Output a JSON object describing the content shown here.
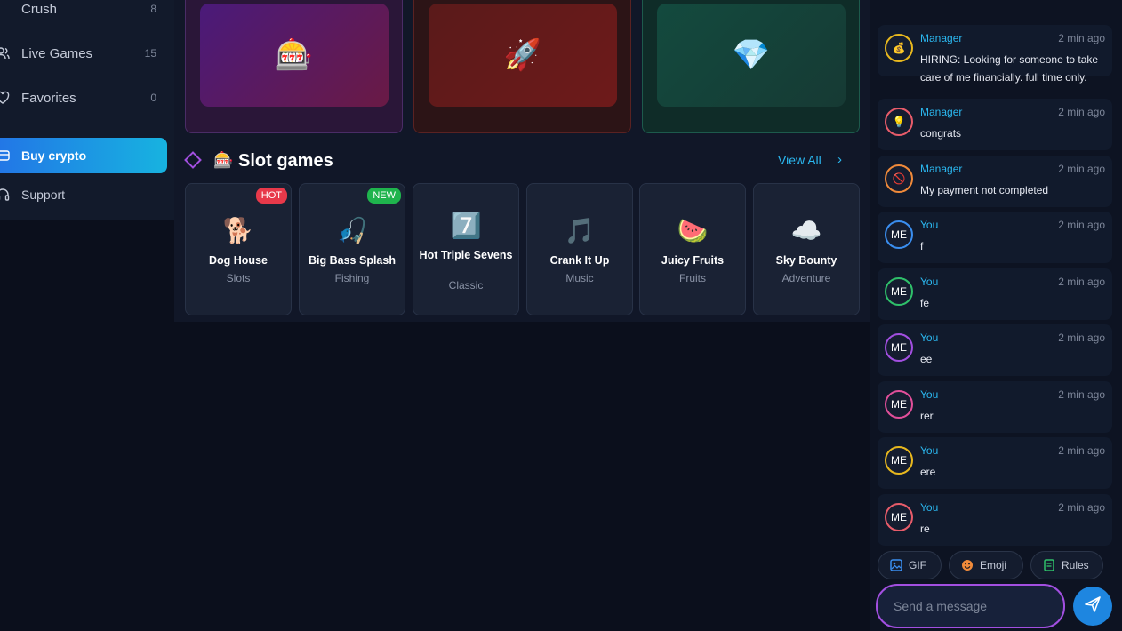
{
  "sidebar": {
    "items": [
      {
        "label": "Crush",
        "count": "8"
      },
      {
        "label": "Live Games",
        "count": "15"
      },
      {
        "label": "Favorites",
        "count": "0"
      }
    ],
    "buy_crypto": "Buy crypto",
    "support": "Support"
  },
  "featured": [
    {
      "emoji": "🎰"
    },
    {
      "emoji": "🚀"
    },
    {
      "emoji": "💎"
    }
  ],
  "slot_section": {
    "icon": "🎰",
    "title": "Slot games",
    "view_all": "View All",
    "chevron": "›"
  },
  "games": [
    {
      "emoji": "🐕",
      "name": "Dog House",
      "category": "Slots",
      "badge": "HOT"
    },
    {
      "emoji": "🎣",
      "name": "Big Bass Splash",
      "category": "Fishing",
      "badge": "NEW"
    },
    {
      "emoji": "7️⃣",
      "name": "Hot Triple Sevens",
      "category": "Classic"
    },
    {
      "emoji": "🎵",
      "name": "Crank It Up",
      "category": "Music"
    },
    {
      "emoji": "🍉",
      "name": "Juicy Fruits",
      "category": "Fruits"
    },
    {
      "emoji": "☁️",
      "name": "Sky Bounty",
      "category": "Adventure"
    }
  ],
  "chat": {
    "messages": [
      {
        "user": "Manager",
        "time": "2 min ago",
        "text": "HIRING: Looking for someone to take care of me financially. full time only.",
        "avatar": "💰",
        "ring": "#e8b81e"
      },
      {
        "user": "Manager",
        "time": "2 min ago",
        "text": "congrats",
        "avatar": "💡",
        "ring": "#e85c6a"
      },
      {
        "user": "Manager",
        "time": "2 min ago",
        "text": "My payment not completed",
        "avatar": "🚫",
        "ring": "#f08a3a"
      },
      {
        "user": "You",
        "time": "2 min ago",
        "text": "f",
        "avatar": "ME",
        "ring": "#3a8ef0"
      },
      {
        "user": "You",
        "time": "2 min ago",
        "text": "fe",
        "avatar": "ME",
        "ring": "#2fc06a"
      },
      {
        "user": "You",
        "time": "2 min ago",
        "text": "ee",
        "avatar": "ME",
        "ring": "#a24fe0"
      },
      {
        "user": "You",
        "time": "2 min ago",
        "text": "rer",
        "avatar": "ME",
        "ring": "#e24f9a"
      },
      {
        "user": "You",
        "time": "2 min ago",
        "text": "ere",
        "avatar": "ME",
        "ring": "#e8b81e"
      },
      {
        "user": "You",
        "time": "2 min ago",
        "text": "re",
        "avatar": "ME",
        "ring": "#e85c6a"
      }
    ],
    "chips": {
      "gif": "GIF",
      "emoji": "Emoji",
      "rules": "Rules"
    },
    "input_placeholder": "Send a message"
  },
  "colors": {
    "accent": "#2bb8f0",
    "purple": "#a24fe0",
    "hot": "#e8394a",
    "new": "#1fb44d"
  }
}
